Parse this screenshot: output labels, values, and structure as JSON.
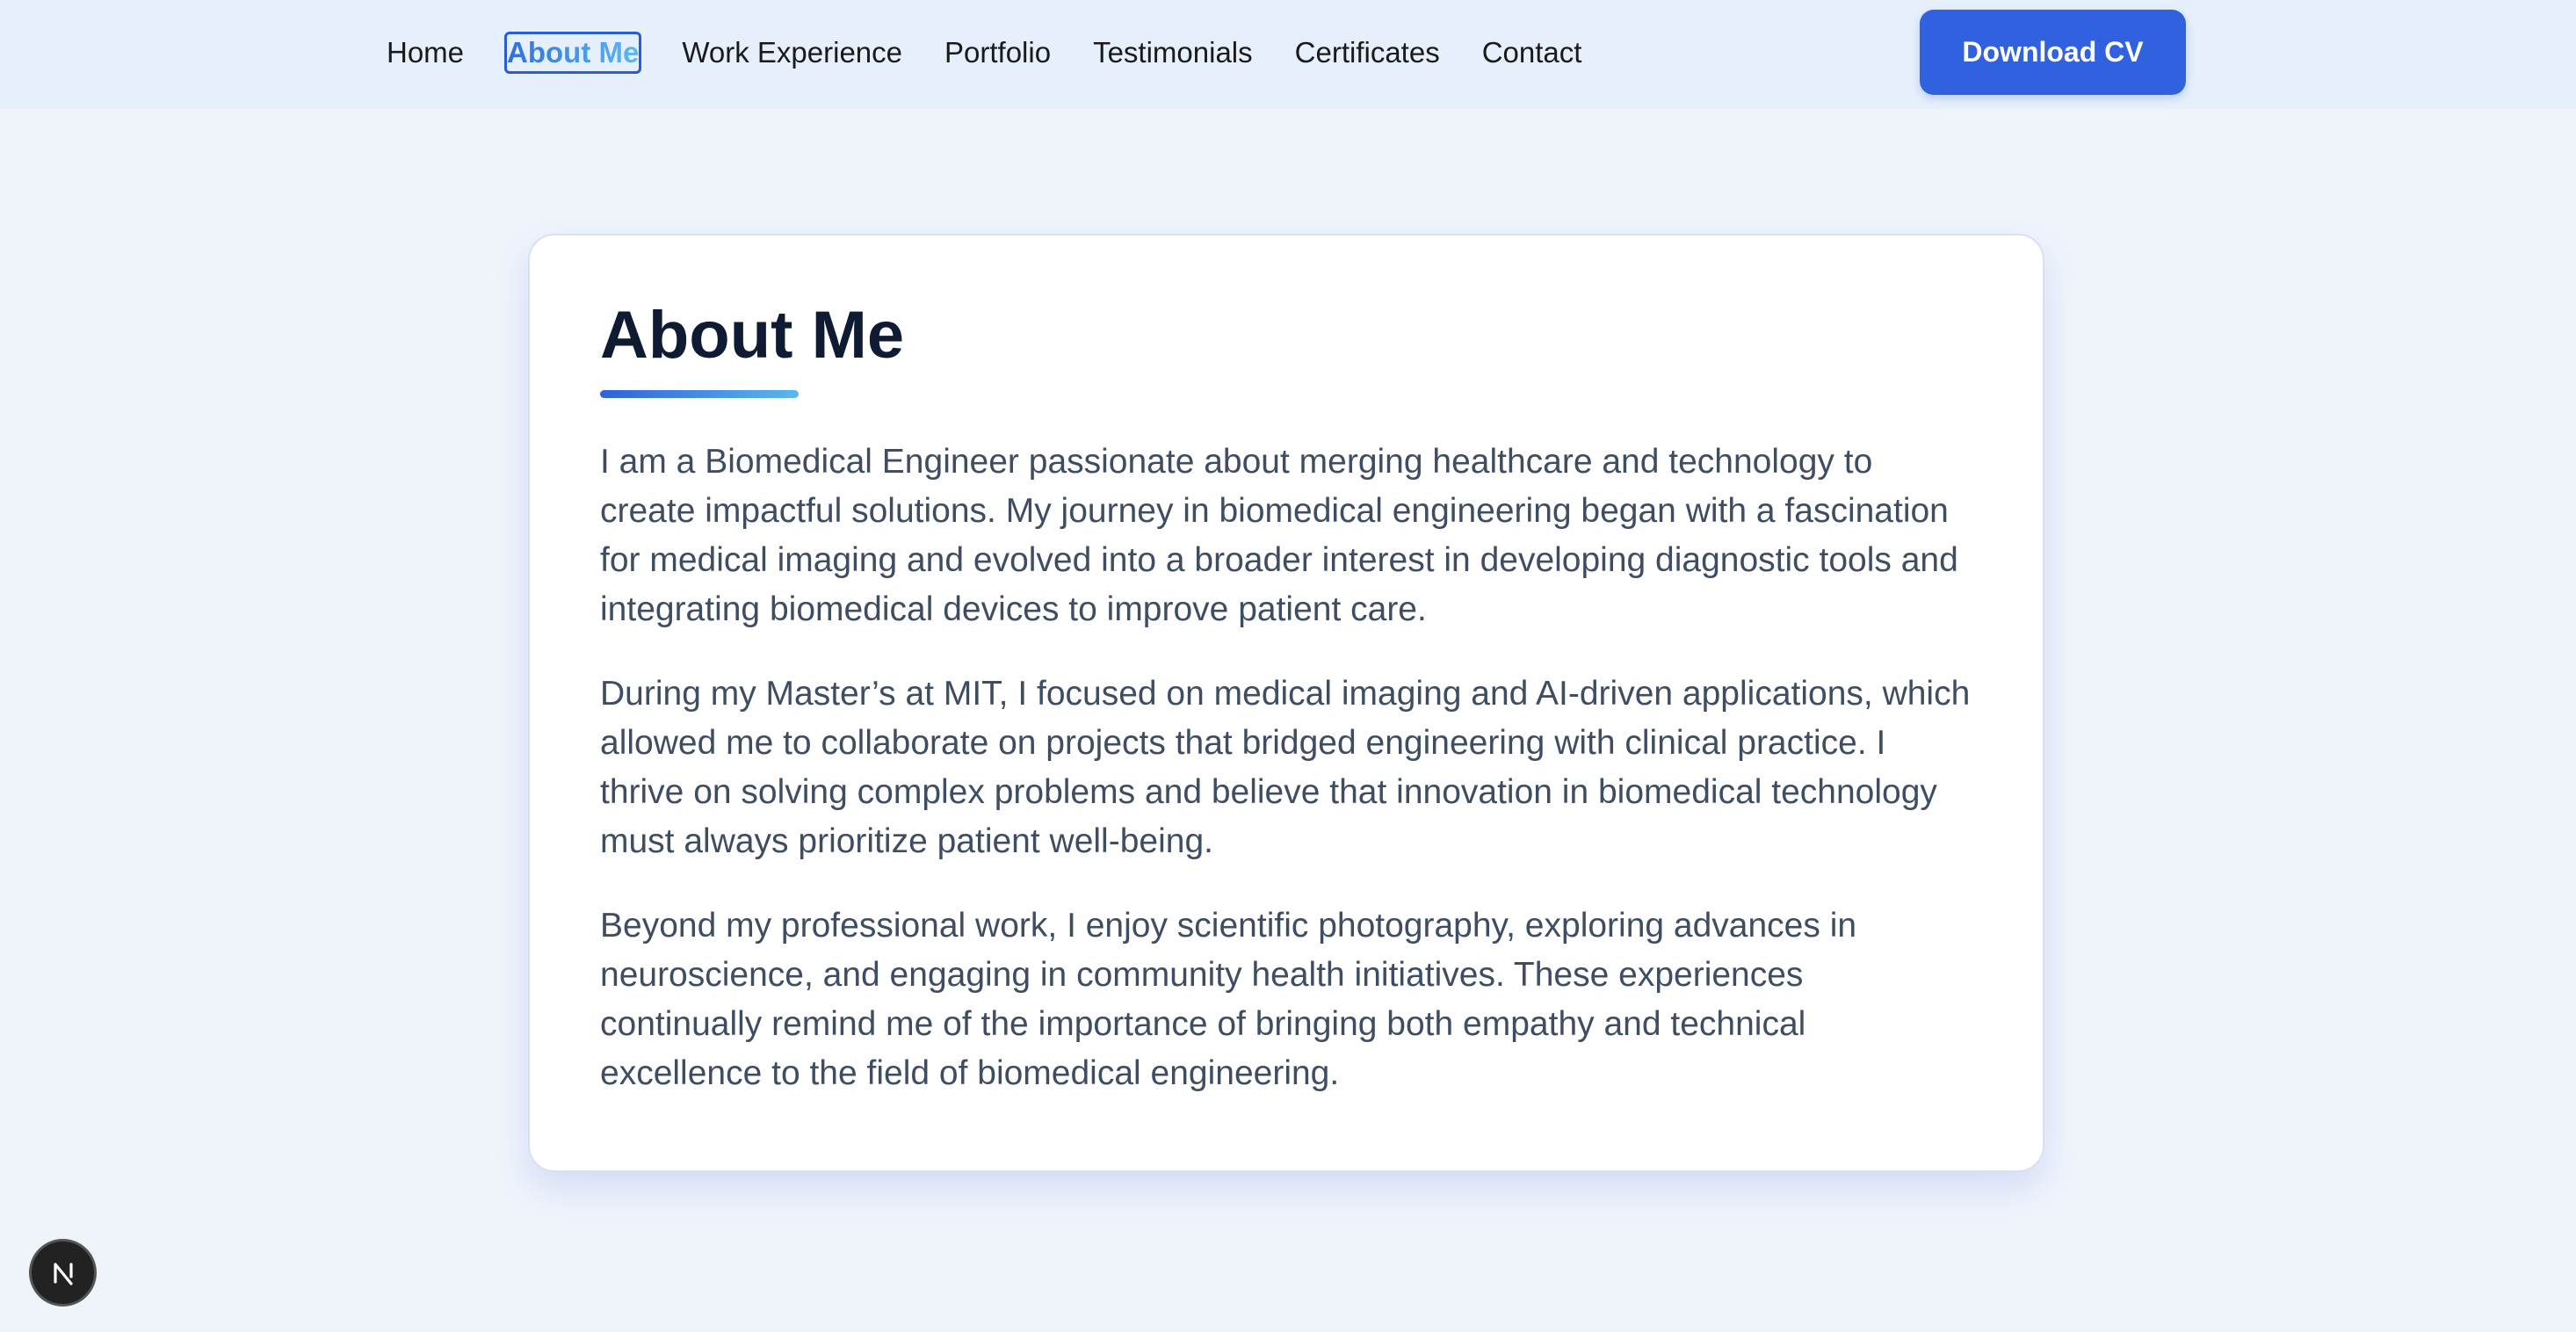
{
  "nav": {
    "items": [
      {
        "label": "Home"
      },
      {
        "label": "About Me"
      },
      {
        "label": "Work Experience"
      },
      {
        "label": "Portfolio"
      },
      {
        "label": "Testimonials"
      },
      {
        "label": "Certificates"
      },
      {
        "label": "Contact"
      }
    ],
    "active": "About Me",
    "cta_label": "Download CV"
  },
  "about": {
    "title": "About Me",
    "paragraphs": [
      "I am a Biomedical Engineer passionate about merging healthcare and technology to create impactful solutions. My journey in biomedical engineering began with a fascination for medical imaging and evolved into a broader interest in developing diagnostic tools and integrating biomedical devices to improve patient care.",
      "During my Master’s at MIT, I focused on medical imaging and AI-driven applications, which allowed me to collaborate on projects that bridged engineering with clinical practice. I thrive on solving complex problems and believe that innovation in biomedical technology must always prioritize patient well-being.",
      "Beyond my professional work, I enjoy scientific photography, exploring advances in neuroscience, and engaging in community health initiatives. These experiences continually remind me of the importance of bringing both empathy and technical excellence to the field of biomedical engineering."
    ]
  },
  "colors": {
    "page_bg": "#eff4fb",
    "nav_bg": "#e6f0fc",
    "accent": "#3062df",
    "title": "#0f1b33",
    "body_text": "#3f4d63"
  },
  "icons": {
    "dev_badge": "nextjs-logo-icon"
  }
}
